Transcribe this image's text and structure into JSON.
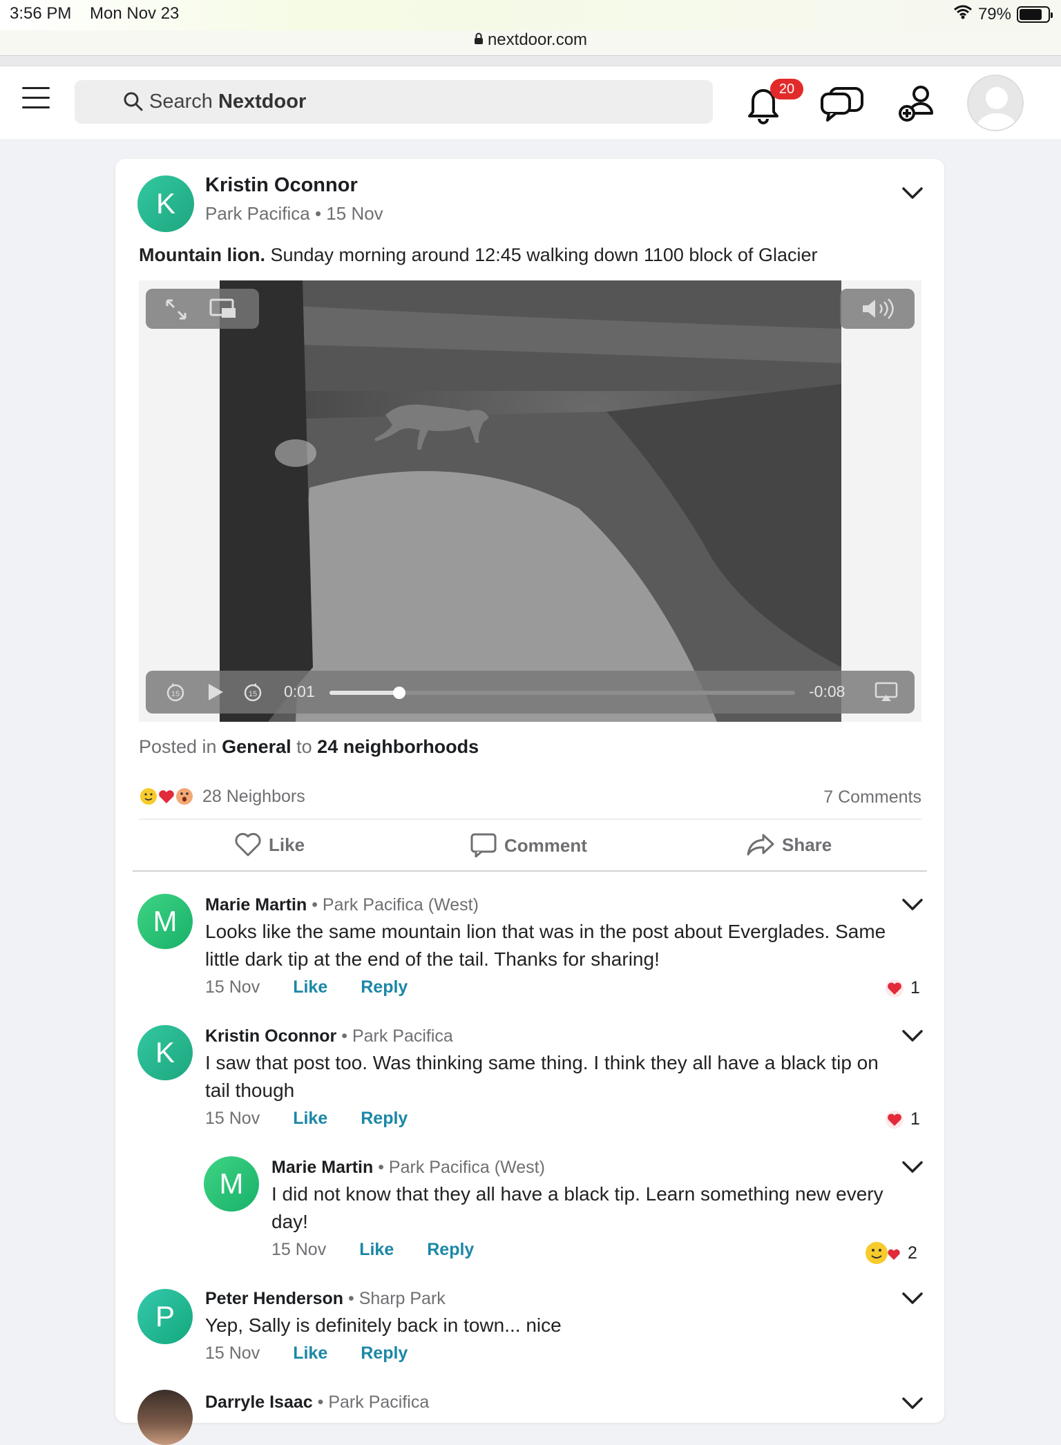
{
  "status": {
    "time": "3:56 PM",
    "date": "Mon Nov 23",
    "battery": "79%",
    "battery_level": 0.79
  },
  "browser": {
    "url": "nextdoor.com"
  },
  "header": {
    "search_prefix": "Search ",
    "search_brand": "Nextdoor",
    "notif_count": "20"
  },
  "post": {
    "author": "Kristin Oconnor",
    "avatar_letter": "K",
    "neighborhood": "Park Pacifica",
    "date": "15 Nov",
    "title": "Mountain lion.",
    "text": " Sunday morning around 12:45 walking down 1100 block of Glacier",
    "video": {
      "elapsed": "0:01",
      "remaining": "-0:08",
      "progress": 0.15,
      "skip": "15"
    },
    "posted_in": "Posted in ",
    "category": "General",
    "to_word": " to ",
    "audience": "24 neighborhoods",
    "reaction_summary": "28 Neighbors",
    "comment_count": "7 Comments",
    "actions": {
      "like": "Like",
      "comment": "Comment",
      "share": "Share"
    }
  },
  "comments": [
    {
      "avatar_letter": "M",
      "name": "Marie Martin",
      "neighborhood": "Park Pacifica (West)",
      "line1": "Looks like the same mountain lion that was in the post about Everglades. Same",
      "line2": "little dark tip at the end of the tail.  Thanks for sharing!",
      "date": "15 Nov",
      "like": "Like",
      "reply": "Reply",
      "reaction_count": "1"
    },
    {
      "avatar_letter": "K",
      "name": "Kristin Oconnor",
      "neighborhood": "Park Pacifica",
      "line1": "I saw that post too. Was thinking same thing. I think they all have a black tip on",
      "line2": "tail though",
      "date": "15 Nov",
      "like": "Like",
      "reply": "Reply",
      "reaction_count": "1"
    },
    {
      "avatar_letter": "M",
      "name": "Marie Martin",
      "neighborhood": "Park Pacifica (West)",
      "line1": "I did not know that they all have a black tip.  Learn something new every",
      "line2": "day!",
      "date": "15 Nov",
      "like": "Like",
      "reply": "Reply",
      "reaction_count": "2"
    },
    {
      "avatar_letter": "P",
      "name": "Peter Henderson",
      "neighborhood": "Sharp Park",
      "line1": "Yep, Sally is definitely back in town... nice",
      "date": "15 Nov",
      "like": "Like",
      "reply": "Reply"
    },
    {
      "name": "Darryle Isaac",
      "neighborhood": "Park Pacifica"
    }
  ],
  "sep": " • "
}
